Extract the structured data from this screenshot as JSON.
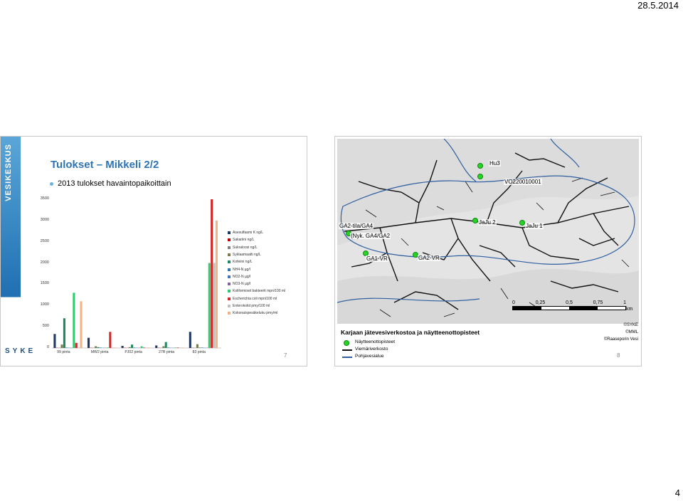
{
  "header": {
    "date": "28.5.2014"
  },
  "footer": {
    "page_number": "4"
  },
  "slide1": {
    "sidebar_text": "VESIKESKUS",
    "title": "Tulokset – Mikkeli 2/2",
    "subtitle": "2013 tulokset havaintopaikoittain",
    "logo_text": "SYKE",
    "slide_number": "7",
    "chart_data": {
      "type": "bar",
      "title": "",
      "xlabel": "",
      "ylabel": "",
      "ylim": [
        0,
        3500
      ],
      "yticks": [
        "3500",
        "3000",
        "2500",
        "2000",
        "1500",
        "1000",
        "500",
        "0"
      ],
      "categories": [
        "99 pinta",
        "MW2 pinta",
        "PJ02 pinta",
        "27R pinta",
        "83 pinta"
      ],
      "series": [
        {
          "name": "Asesulfaami K ng/L",
          "color": "#1f3864",
          "values": [
            330,
            240,
            50,
            60,
            380
          ]
        },
        {
          "name": "Sakariini ng/L",
          "color": "#c00000",
          "values": [
            5,
            5,
            5,
            5,
            5
          ]
        },
        {
          "name": "Sukraloosi ng/L",
          "color": "#7f7f7f",
          "values": [
            5,
            5,
            5,
            5,
            5
          ]
        },
        {
          "name": "Syklaamaatti ng/L",
          "color": "#7a7a4d",
          "values": [
            80,
            40,
            20,
            40,
            90
          ]
        },
        {
          "name": "Kofeiini ng/L",
          "color": "#1f8a5b",
          "values": [
            700,
            20,
            80,
            140,
            10
          ]
        },
        {
          "name": "NH4-N µg/l",
          "color": "#2e75b6",
          "values": [
            10,
            10,
            10,
            10,
            10
          ]
        },
        {
          "name": "NO2-N µg/l",
          "color": "#4472c4",
          "values": [
            5,
            5,
            5,
            5,
            5
          ]
        },
        {
          "name": "NO3-N µg/l",
          "color": "#8064a2",
          "values": [
            5,
            5,
            5,
            5,
            5
          ]
        },
        {
          "name": "Koliformiset bakteerit mpn/100 ml",
          "color": "#2ecc71",
          "values": [
            1300,
            10,
            40,
            10,
            2000
          ]
        },
        {
          "name": "Escherichia coli mpn/100 ml",
          "color": "#d62728",
          "values": [
            120,
            380,
            10,
            10,
            3500
          ]
        },
        {
          "name": "Enterokokit pmy/100 ml",
          "color": "#c0c0c0",
          "values": [
            10,
            10,
            10,
            10,
            2000
          ]
        },
        {
          "name": "Kokonaispesäkeluku pmy/ml",
          "color": "#f4b183",
          "values": [
            1100,
            10,
            10,
            10,
            3000
          ]
        }
      ]
    }
  },
  "slide2": {
    "map_labels": {
      "hu3": "Hu3",
      "vo": "VO220010001",
      "ga2_tila": "GA2-tila/GA4",
      "nyk": "(Nyk. GA4/GA2",
      "jaju2": "JaJu 2",
      "jaju1": "JaJu 1",
      "ga1vr": "GA1-VR",
      "ga2vr": "GA2-VR"
    },
    "scale": {
      "t0": "0",
      "t1": "0,25",
      "t2": "0,5",
      "t3": "0,75",
      "t4": "1",
      "unit": "km"
    },
    "legend_title": "Karjaan jätevesiverkostoa ja näytteenottopisteet",
    "legend": {
      "points": "Näytteenottopisteet",
      "network": "Viemäriverkosto",
      "groundwater": "Pohjavesialue"
    },
    "copyright": {
      "c1": "©SYKE",
      "c2": "©MML",
      "c3": "©Raaseporin Vesi"
    },
    "slide_number": "8"
  }
}
